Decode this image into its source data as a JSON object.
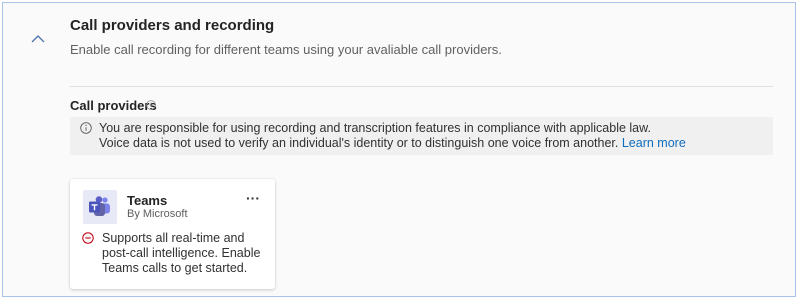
{
  "section": {
    "title": "Call providers and recording",
    "subtitle": "Enable call recording for different teams using your avaliable call providers."
  },
  "providers": {
    "label": "Call providers"
  },
  "notice": {
    "line1": "You are responsible for using recording and transcription features in compliance with applicable law.",
    "line2": "Voice data is not used to verify an individual's identity or to distinguish one voice from another.",
    "link": "Learn more"
  },
  "card": {
    "name": "Teams",
    "vendor": "By Microsoft",
    "more": "···",
    "status_icon": "blocked-icon",
    "description": "Supports all real-time and post-call intelligence. Enable Teams calls to get started."
  },
  "colors": {
    "link": "#0f6cbd",
    "error": "#c50f1f",
    "teams_purple": "#5b5fc7",
    "notice_bg": "#f0f0f0"
  }
}
